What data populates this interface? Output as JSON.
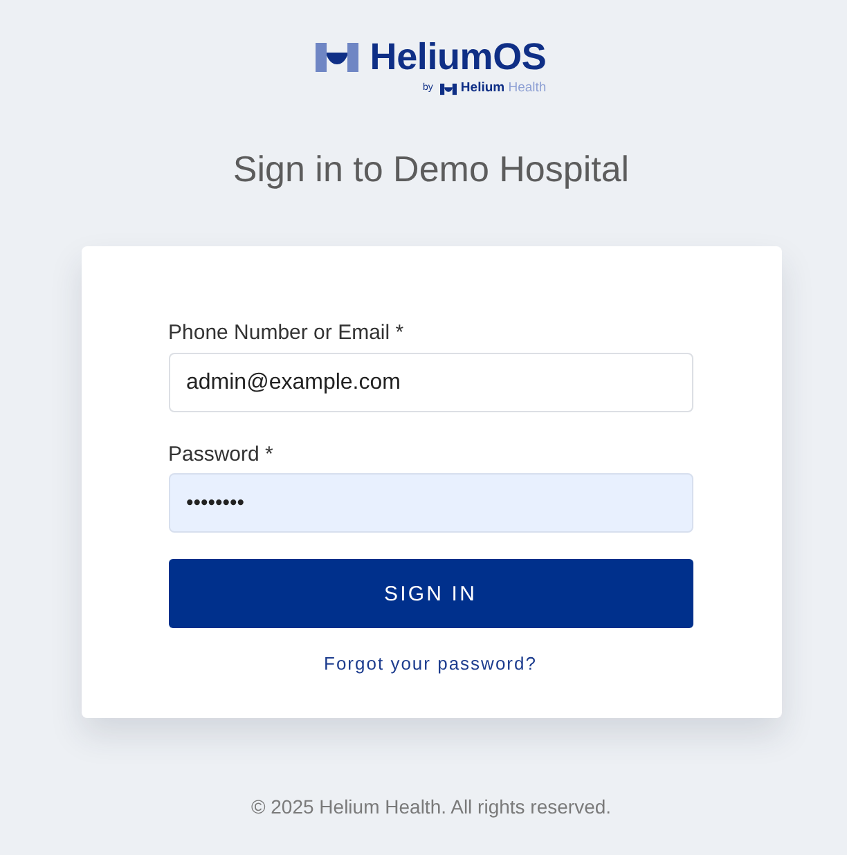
{
  "logo": {
    "name": "HeliumOS",
    "byline": "by",
    "maker": "**Helium** Health"
  },
  "title": "Sign in to Demo Hospital",
  "form": {
    "fields": [
      {
        "kind": "text",
        "label": "Phone Number or Email *",
        "value": "admin@example.com",
        "autofilled": false
      },
      {
        "kind": "password",
        "label": "Password *",
        "value": "••••••••",
        "autofilled": true
      }
    ],
    "submit": "SIGN IN",
    "link": "Forgot your password?"
  },
  "footer": "© 2025 Helium Health. All rights reserved."
}
